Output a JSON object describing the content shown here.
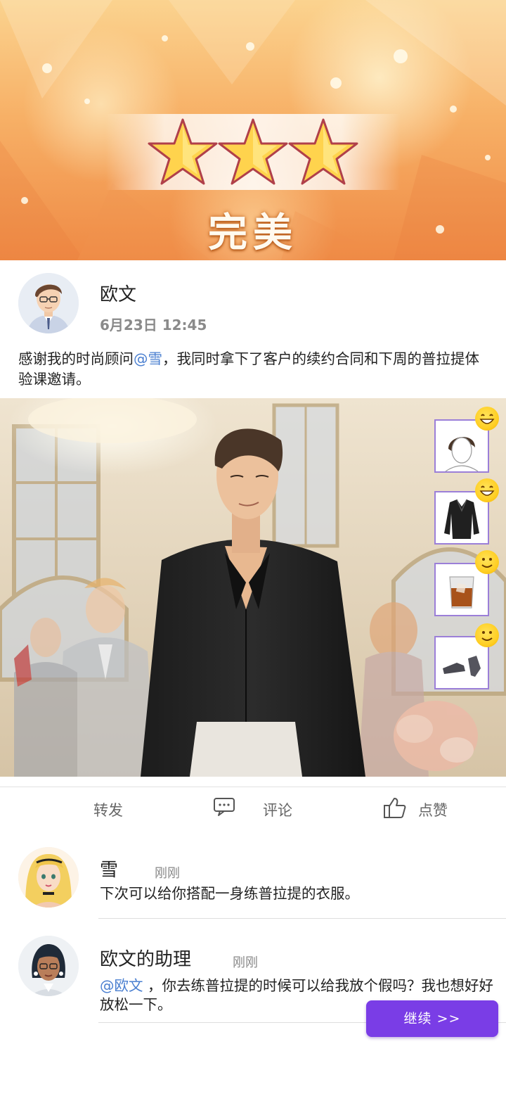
{
  "banner": {
    "rating_word": "完美",
    "star_count": 3,
    "colors": {
      "star_fill": "#ffd34d",
      "star_outline": "#b0404a"
    }
  },
  "post": {
    "author": "欧文",
    "time": "6月23日 12:45",
    "text_before": "感谢我的时尚顾问",
    "mention": "@雪",
    "text_after": "，我同时拿下了客户的续约合同和下周的普拉提体验课邀请。"
  },
  "outfit_items": [
    {
      "icon": "hairstyle-icon",
      "reaction": "grin-emoji-icon"
    },
    {
      "icon": "black-shirt-icon",
      "reaction": "grin-emoji-icon"
    },
    {
      "icon": "whiskey-glass-icon",
      "reaction": "smile-emoji-icon"
    },
    {
      "icon": "shoes-icon",
      "reaction": "smile-emoji-icon"
    }
  ],
  "actions": {
    "share": "转发",
    "comment": "评论",
    "like": "点赞"
  },
  "comments": [
    {
      "name": "雪",
      "time": "刚刚",
      "text": "下次可以给你搭配一身练普拉提的衣服。"
    },
    {
      "name": "欧文的助理",
      "time": "刚刚",
      "mention": "@欧文",
      "text": " ，你去练普拉提的时候可以给我放个假吗？我也想好好放松一下。"
    }
  ],
  "continue_button": "继续 >>",
  "colors": {
    "accent": "#7a3de6",
    "mention": "#4a7fd0",
    "card_border": "#9b7fd8"
  }
}
